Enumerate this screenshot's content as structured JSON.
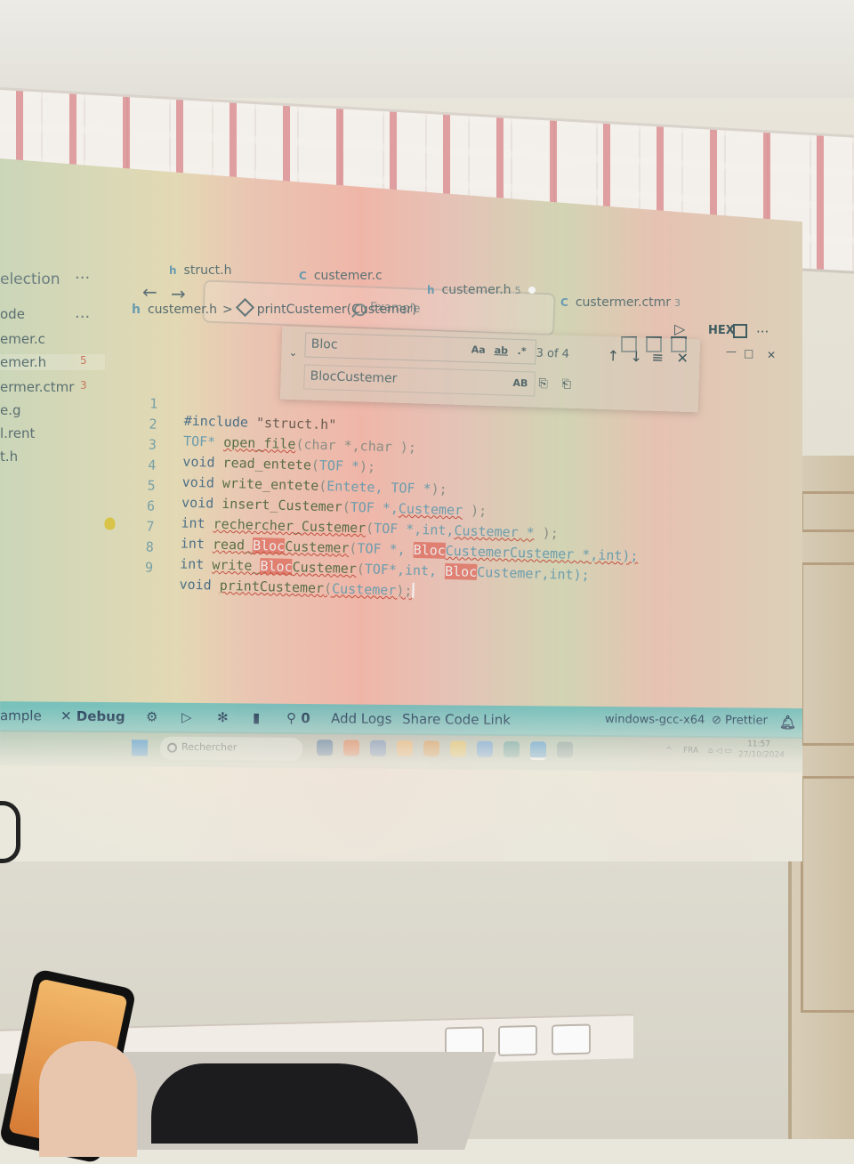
{
  "explorer": {
    "title": "election",
    "more": "···",
    "files": [
      {
        "label": "ode",
        "badge": ""
      },
      {
        "label": "emer.c",
        "badge": ""
      },
      {
        "label": "emer.h",
        "badge": "5"
      },
      {
        "label": "ermer.ctmr",
        "badge": "3"
      },
      {
        "label": "e.g",
        "badge": ""
      },
      {
        "label": "l.rent",
        "badge": ""
      },
      {
        "label": "t.h",
        "badge": ""
      }
    ]
  },
  "titlebar": {
    "back": "←",
    "forward": "→",
    "search_text": "Example"
  },
  "tabs": [
    {
      "icon": "h",
      "label": "struct.h",
      "badge": ""
    },
    {
      "icon": "C",
      "label": "custemer.c",
      "badge": ""
    },
    {
      "icon": "h",
      "label": "custemer.h",
      "badge": "5"
    },
    {
      "icon": "C",
      "label": "custermer.ctmr",
      "badge": "3"
    }
  ],
  "breadcrumb": {
    "file": "custemer.h",
    "sep": ">",
    "symbol": "printCustemer(Custemer)"
  },
  "editor_actions": {
    "run": "▷",
    "hex": "HEX",
    "more": "···"
  },
  "find": {
    "query": "Bloc",
    "replace": "BlocCustemer",
    "match_case": "Aa",
    "whole_word": "ab",
    "regex": ".*",
    "preserve_case": "AB",
    "count": "3 of 4",
    "prev": "↑",
    "next": "↓",
    "selection": "≡",
    "close": "✕"
  },
  "code_lines": [
    {
      "num": "1"
    },
    {
      "num": "2"
    },
    {
      "num": "3"
    },
    {
      "num": "4"
    },
    {
      "num": "5"
    },
    {
      "num": "6"
    },
    {
      "num": "7"
    },
    {
      "num": "8"
    },
    {
      "num": "9"
    }
  ],
  "code": {
    "l1": {
      "kw": "#include",
      "str": "\"struct.h\""
    },
    "l2": {
      "ty": "TOF*",
      "fn": "open_file",
      "p1": "(",
      "a": "char *",
      "c": ",",
      "b": "char",
      "p2": " );"
    },
    "l3": {
      "kw": "void",
      "fn": "read_entete",
      "p1": "(",
      "a": "TOF *",
      "p2": ");"
    },
    "l4": {
      "kw": "void",
      "fn": "write_entete",
      "p1": "(",
      "a": "Entete, TOF *",
      "p2": ");"
    },
    "l5": {
      "kw": "void",
      "fn": "insert_Custemer",
      "p1": "(",
      "a": "TOF *,",
      "b": "Custemer",
      "p2": " );"
    },
    "l6": {
      "kw": "int",
      "fn": "rechercher_Custemer",
      "p1": "(",
      "a": "TOF *,int,",
      "b": "Custemer *",
      "p2": " );"
    },
    "l7": {
      "kw": "int",
      "fn1": "read_",
      "hl": "Bloc",
      "fn2": "Custemer",
      "p1": "(",
      "a": "TOF *, ",
      "hl2": "Bloc",
      "b": "CustemerCustemer *,int);"
    },
    "l8": {
      "kw": "int",
      "fn1": "write_",
      "hl": "Bloc",
      "fn2": "Custemer",
      "p1": "(",
      "a": "TOF*,int, ",
      "hl2": "Bloc",
      "b": "Custemer,int);"
    },
    "l9": {
      "kw": "void",
      "fn": "printCustemer",
      "p1": "(",
      "a": "Custemer",
      "p2": ");"
    }
  },
  "statusbar": {
    "left_text": "ample",
    "debug": "Debug",
    "ports": "0",
    "add_logs": "Add Logs",
    "share": "Share Code Link",
    "compiler": "windows-gcc-x64",
    "prettier": "Prettier"
  },
  "taskbar": {
    "search": "Rechercher",
    "lang": "FRA",
    "time": "11:57",
    "date": "27/10/2024"
  },
  "colors": {
    "statusbar": "#66bcbc",
    "highlight": "#dc5c4e",
    "keyword": "#4c6f86"
  }
}
